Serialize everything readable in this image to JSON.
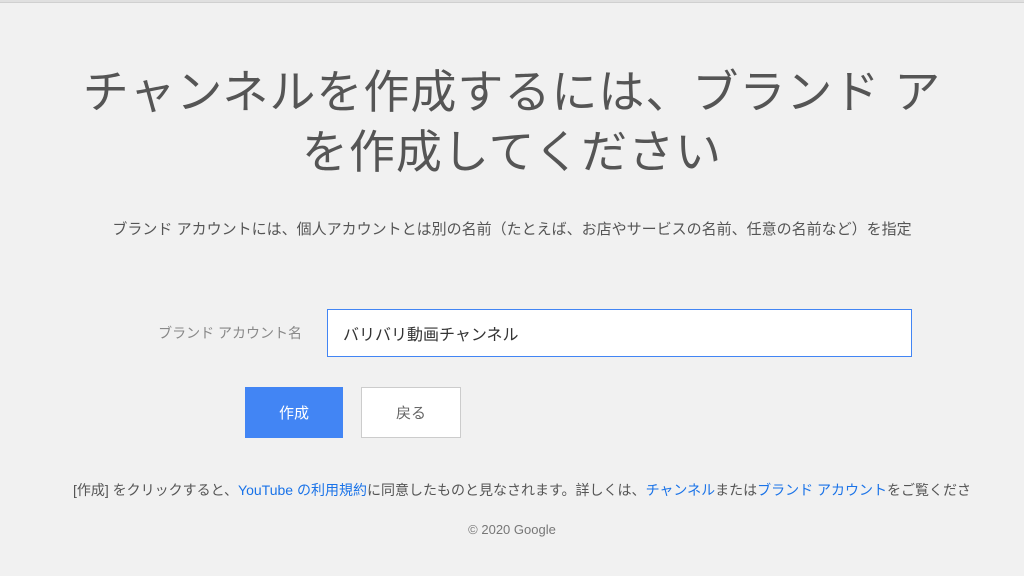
{
  "heading_line1": "チャンネルを作成するには、ブランド ア",
  "heading_line2": "を作成してください",
  "description": "ブランド アカウントには、個人アカウントとは別の名前（たとえば、お店やサービスの名前、任意の名前など）を指定",
  "form": {
    "label": "ブランド アカウント名",
    "value": "バリバリ動画チャンネル"
  },
  "buttons": {
    "create": "作成",
    "back": "戻る"
  },
  "notice": {
    "text1": "[作成] をクリックすると、",
    "link1": "YouTube の利用規約",
    "text2": "に同意したものと見なされます。詳しくは、",
    "link2": "チャンネル",
    "text3": "または",
    "link3": "ブランド アカウント",
    "text4": "をご覧くださ"
  },
  "copyright": "© 2020 Google"
}
